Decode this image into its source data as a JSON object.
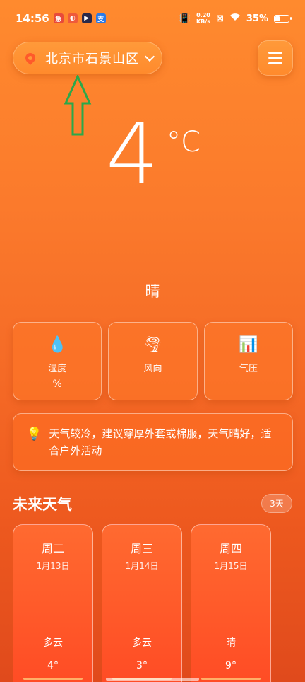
{
  "status_bar": {
    "time": "14:56",
    "app_icons": [
      {
        "name": "app-icon-1",
        "glyph": "急",
        "color": "#e84a3a"
      },
      {
        "name": "app-icon-2",
        "glyph": "◐",
        "color": "#ef5a3a"
      },
      {
        "name": "app-icon-3",
        "glyph": "▶",
        "color": "#2a2a4a"
      },
      {
        "name": "app-icon-4",
        "glyph": "支",
        "color": "#2a7ae8"
      }
    ],
    "net_speed_value": "0.20",
    "net_speed_unit": "KB/s",
    "battery": "35%",
    "battery_level": 0.35
  },
  "header": {
    "location": "北京市石景山区"
  },
  "current": {
    "temperature": "4",
    "unit": "°C",
    "condition": "晴"
  },
  "metrics": [
    {
      "icon": "💧",
      "label": "湿度",
      "value": "%"
    },
    {
      "icon": "🌪",
      "label": "风向",
      "value": ""
    },
    {
      "icon": "📊",
      "label": "气压",
      "value": ""
    }
  ],
  "advice": {
    "icon": "💡",
    "text": "天气较冷，建议穿厚外套或棉服，天气晴好，适合户外活动"
  },
  "forecast": {
    "title": "未来天气",
    "badge": "3天",
    "days": [
      {
        "day": "周二",
        "date": "1月13日",
        "condition": "多云",
        "temp": "4°"
      },
      {
        "day": "周三",
        "date": "1月14日",
        "condition": "多云",
        "temp": "3°"
      },
      {
        "day": "周四",
        "date": "1月15日",
        "condition": "晴",
        "temp": "9°"
      }
    ]
  },
  "colors": {
    "background_top": "#ff8a2e",
    "background_bottom": "#e04a1c",
    "card_accent": "#ff4a24",
    "annotation_arrow": "#2aa84a"
  }
}
